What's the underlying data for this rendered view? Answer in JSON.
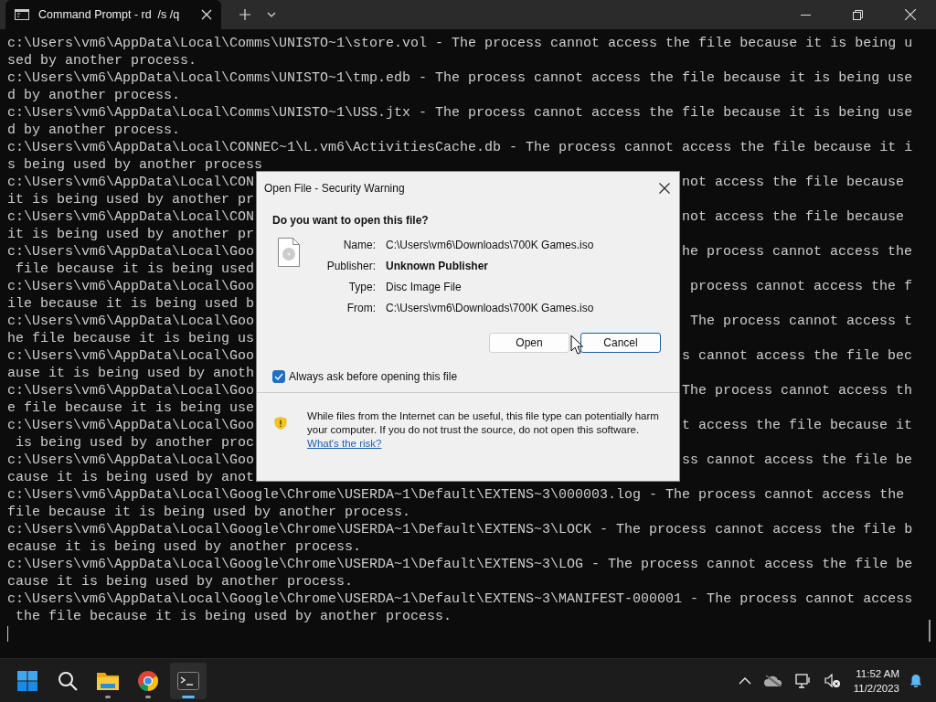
{
  "window": {
    "tab_title": "Command Prompt - rd  /s /q"
  },
  "terminal": {
    "lines": [
      {
        "left": "c:\\Users\\vm6\\AppData\\Local\\Comms\\UNISTO~1\\store.vol - The process cannot access the file because it is being u"
      },
      {
        "left": "sed by another process."
      },
      {
        "left": "c:\\Users\\vm6\\AppData\\Local\\Comms\\UNISTO~1\\tmp.edb - The process cannot access the file because it is being use"
      },
      {
        "left": "d by another process."
      },
      {
        "left": "c:\\Users\\vm6\\AppData\\Local\\Comms\\UNISTO~1\\USS.jtx - The process cannot access the file because it is being use"
      },
      {
        "left": "d by another process."
      },
      {
        "left": "c:\\Users\\vm6\\AppData\\Local\\CONNEC~1\\L.vm6\\ActivitiesCache.db - The process cannot access the file because it i"
      },
      {
        "left": "s being used by another process"
      },
      {
        "left": "c:\\Users\\vm6\\AppData\\Local\\CON",
        "right": "not access the file because "
      },
      {
        "left": "it is being used by another pr"
      },
      {
        "left": "c:\\Users\\vm6\\AppData\\Local\\CON",
        "right": "not access the file because "
      },
      {
        "left": "it is being used by another pr"
      },
      {
        "left": "c:\\Users\\vm6\\AppData\\Local\\Goo",
        "right": "he process cannot access the"
      },
      {
        "left": " file because it is being used"
      },
      {
        "left": "c:\\Users\\vm6\\AppData\\Local\\Goo",
        "right": "process cannot access the f"
      },
      {
        "left": "ile because it is being used b"
      },
      {
        "left": "c:\\Users\\vm6\\AppData\\Local\\Goo",
        "right": "The process cannot access t"
      },
      {
        "left": "he file because it is being us"
      },
      {
        "left": "c:\\Users\\vm6\\AppData\\Local\\Goo",
        "right": "s cannot access the file bec"
      },
      {
        "left": "ause it is being used by anoth"
      },
      {
        "left": "c:\\Users\\vm6\\AppData\\Local\\Goo",
        "right": "The process cannot access th"
      },
      {
        "left": "e file because it is being use"
      },
      {
        "left": "c:\\Users\\vm6\\AppData\\Local\\Goo",
        "right": "t access the file because it"
      },
      {
        "left": " is being used by another proc"
      },
      {
        "left": "c:\\Users\\vm6\\AppData\\Local\\Goo",
        "right": "ss cannot access the file be"
      },
      {
        "left": "cause it is being used by anot"
      },
      {
        "left": "c:\\Users\\vm6\\AppData\\Local\\Google\\Chrome\\USERDA~1\\Default\\EXTENS~3\\000003.log - The process cannot access the"
      },
      {
        "left": "file because it is being used by another process."
      },
      {
        "left": "c:\\Users\\vm6\\AppData\\Local\\Google\\Chrome\\USERDA~1\\Default\\EXTENS~3\\LOCK - The process cannot access the file b"
      },
      {
        "left": "ecause it is being used by another process."
      },
      {
        "left": "c:\\Users\\vm6\\AppData\\Local\\Google\\Chrome\\USERDA~1\\Default\\EXTENS~3\\LOG - The process cannot access the file be"
      },
      {
        "left": "cause it is being used by another process."
      },
      {
        "left": "c:\\Users\\vm6\\AppData\\Local\\Google\\Chrome\\USERDA~1\\Default\\EXTENS~3\\MANIFEST-000001 - The process cannot access"
      },
      {
        "left": " the file because it is being used by another process."
      }
    ]
  },
  "dialog": {
    "title": "Open File - Security Warning",
    "heading": "Do you want to open this file?",
    "fields": [
      {
        "label": "Name:",
        "value": "C:\\Users\\vm6\\Downloads\\700K Games.iso",
        "bold": false
      },
      {
        "label": "Publisher:",
        "value": "Unknown Publisher",
        "bold": true
      },
      {
        "label": "Type:",
        "value": "Disc Image File",
        "bold": false
      },
      {
        "label": "From:",
        "value": "C:\\Users\\vm6\\Downloads\\700K Games.iso",
        "bold": false
      }
    ],
    "buttons": [
      {
        "label": "Open",
        "focused": false
      },
      {
        "label": "Cancel",
        "focused": true
      }
    ],
    "checkbox": {
      "label": "Always ask before opening this file",
      "checked": true
    },
    "warning": {
      "text": "While files from the Internet can be useful, this file type can potentially harm your computer. If you do not trust the source, do not open this software.",
      "link": "What's the risk?"
    }
  },
  "taskbar": {
    "apps": [
      {
        "kind": "start",
        "running": false,
        "active": false
      },
      {
        "kind": "search",
        "running": false,
        "active": false
      },
      {
        "kind": "folder",
        "running": true,
        "active": false
      },
      {
        "kind": "browser",
        "running": true,
        "active": false
      },
      {
        "kind": "terminal",
        "running": true,
        "active": true
      }
    ],
    "time": "11:52 AM",
    "date": "11/2/2023"
  }
}
